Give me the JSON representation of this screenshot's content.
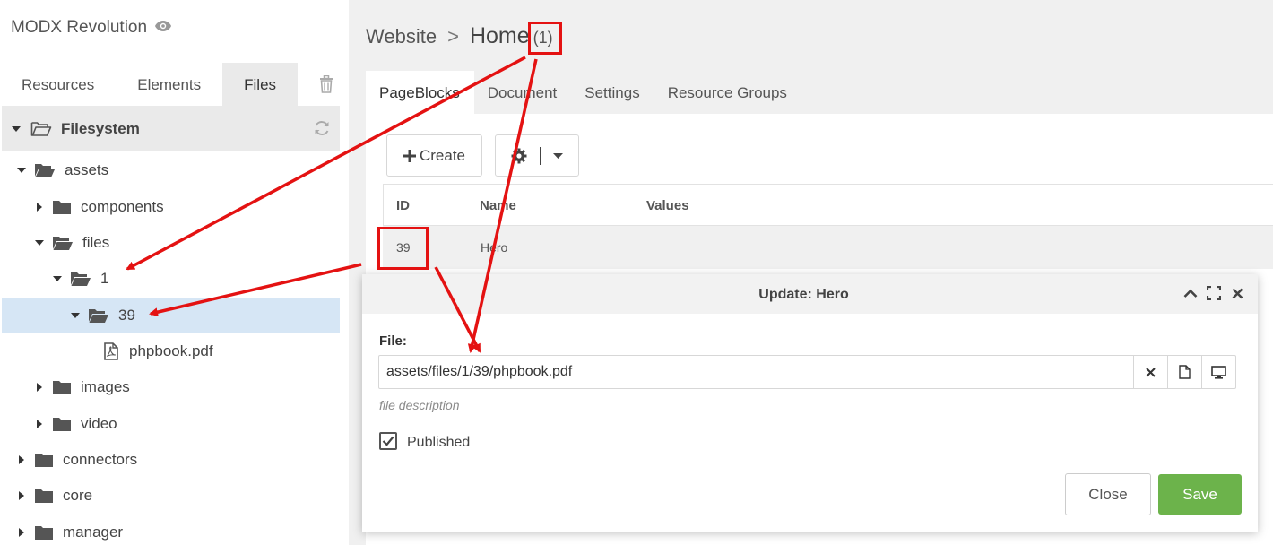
{
  "app": {
    "title": "MODX Revolution"
  },
  "sidebar": {
    "tabs": [
      {
        "label": "Resources"
      },
      {
        "label": "Elements"
      },
      {
        "label": "Files"
      }
    ],
    "filesystem_label": "Filesystem",
    "tree": [
      {
        "label": "assets"
      },
      {
        "label": "components"
      },
      {
        "label": "files"
      },
      {
        "label": "1"
      },
      {
        "label": "39"
      },
      {
        "label": "phpbook.pdf"
      },
      {
        "label": "images"
      },
      {
        "label": "video"
      },
      {
        "label": "connectors"
      },
      {
        "label": "core"
      },
      {
        "label": "manager"
      }
    ]
  },
  "breadcrumb": {
    "parent": "Website",
    "separator": ">",
    "current": "Home",
    "count": "(1)"
  },
  "main_tabs": [
    {
      "label": "PageBlocks"
    },
    {
      "label": "Document"
    },
    {
      "label": "Settings"
    },
    {
      "label": "Resource Groups"
    }
  ],
  "toolbar": {
    "create_label": "Create"
  },
  "grid": {
    "columns": [
      "ID",
      "Name",
      "Values"
    ],
    "rows": [
      {
        "id": "39",
        "name": "Hero",
        "values": ""
      }
    ]
  },
  "modal": {
    "title": "Update: Hero",
    "file_label": "File:",
    "file_value": "assets/files/1/39/phpbook.pdf",
    "file_description": "file description",
    "published_label": "Published",
    "published_checked": true,
    "close_label": "Close",
    "save_label": "Save"
  },
  "colors": {
    "annotation": "#e41212",
    "save_button": "#6cb34b",
    "selected_row": "#d6e6f5"
  }
}
